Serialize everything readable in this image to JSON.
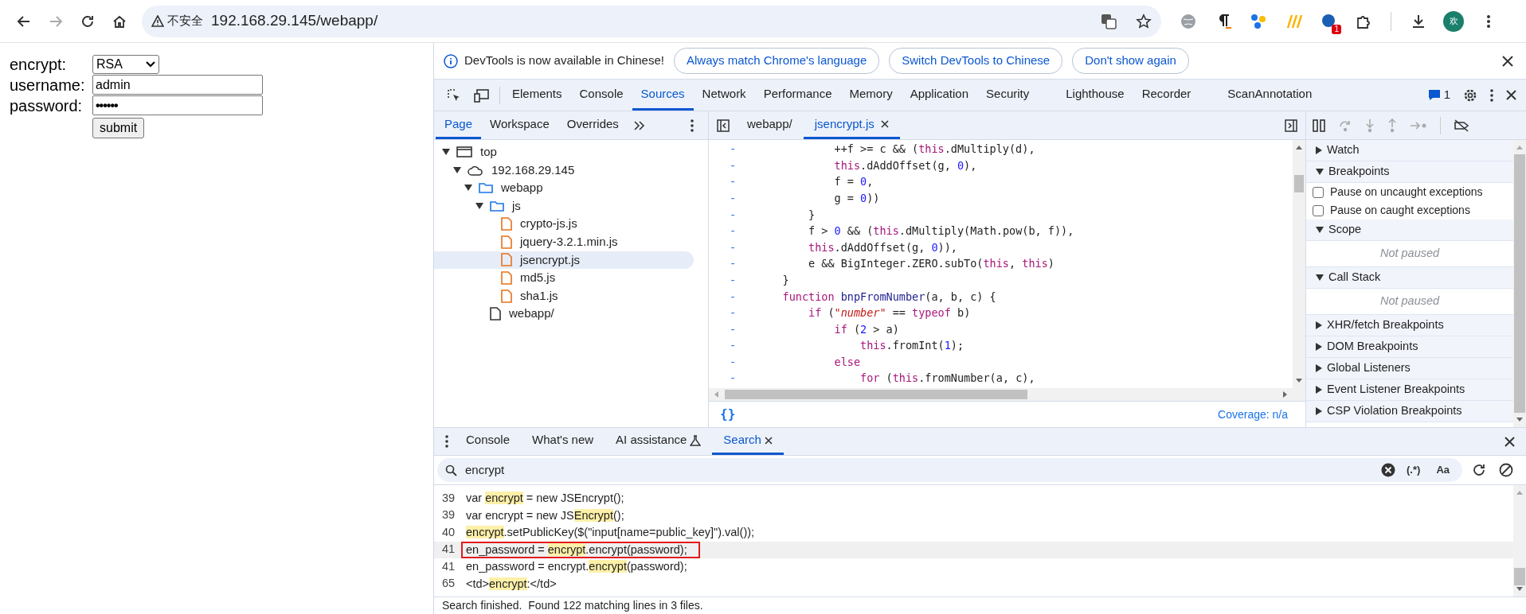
{
  "browser": {
    "security_label": "不安全",
    "url": "192.168.29.145/webapp/",
    "extension_badge": "1",
    "avatar_text": "欢"
  },
  "form": {
    "rows": [
      {
        "kind": "select",
        "label": "encrypt:",
        "value": "RSA"
      },
      {
        "kind": "text",
        "label": "username:",
        "value": "admin"
      },
      {
        "kind": "password",
        "label": "password:",
        "value": "••••••"
      }
    ],
    "submit": "submit"
  },
  "infobar": {
    "message": "DevTools is now available in Chinese!",
    "buttons": [
      "Always match Chrome's language",
      "Switch DevTools to Chinese",
      "Don't show again"
    ]
  },
  "main_tabs": [
    {
      "label": "Elements",
      "selected": false
    },
    {
      "label": "Console",
      "selected": false
    },
    {
      "label": "Sources",
      "selected": true
    },
    {
      "label": "Network",
      "selected": false
    },
    {
      "label": "Performance",
      "selected": false
    },
    {
      "label": "Memory",
      "selected": false
    },
    {
      "label": "Application",
      "selected": false
    },
    {
      "label": "Security",
      "selected": false
    },
    {
      "label": "Lighthouse",
      "selected": false
    },
    {
      "label": "Recorder",
      "selected": false
    },
    {
      "label": "ScanAnnotation",
      "selected": false
    }
  ],
  "issues_count": "1",
  "navigator_tabs": [
    {
      "label": "Page",
      "selected": true
    },
    {
      "label": "Workspace",
      "selected": false
    },
    {
      "label": "Overrides",
      "selected": false
    }
  ],
  "editor_tabs": [
    {
      "label": "webapp/",
      "selected": false,
      "closable": false
    },
    {
      "label": "jsencrypt.js",
      "selected": true,
      "closable": true
    }
  ],
  "file_tree": [
    {
      "label": "top",
      "kind": "frame",
      "expanded": true,
      "selected": false,
      "children": [
        {
          "label": "192.168.29.145",
          "kind": "domain",
          "expanded": true,
          "selected": false,
          "children": [
            {
              "label": "webapp",
              "kind": "folder",
              "expanded": true,
              "selected": false,
              "children": [
                {
                  "label": "js",
                  "kind": "folder",
                  "expanded": true,
                  "selected": false,
                  "children": [
                    {
                      "label": "crypto-js.js",
                      "kind": "file",
                      "selected": false
                    },
                    {
                      "label": "jquery-3.2.1.min.js",
                      "kind": "file",
                      "selected": false
                    },
                    {
                      "label": "jsencrypt.js",
                      "kind": "file",
                      "selected": true
                    },
                    {
                      "label": "md5.js",
                      "kind": "file",
                      "selected": false
                    },
                    {
                      "label": "sha1.js",
                      "kind": "file",
                      "selected": false
                    }
                  ]
                },
                {
                  "label": "webapp/",
                  "kind": "document",
                  "selected": false
                }
              ]
            }
          ]
        }
      ]
    }
  ],
  "code_lines": [
    {
      "gutter": "-",
      "tokens": [
        {
          "kind": "plain",
          "text": "            ++f >= c && ("
        },
        {
          "kind": "kw",
          "text": "this"
        },
        {
          "kind": "plain",
          "text": ".dMultiply(d),"
        }
      ]
    },
    {
      "gutter": "-",
      "tokens": [
        {
          "kind": "kw",
          "text": "            this"
        },
        {
          "kind": "plain",
          "text": ".dAddOffset(g, "
        },
        {
          "kind": "num",
          "text": "0"
        },
        {
          "kind": "plain",
          "text": "),"
        }
      ]
    },
    {
      "gutter": "-",
      "tokens": [
        {
          "kind": "plain",
          "text": "            f = "
        },
        {
          "kind": "num",
          "text": "0"
        },
        {
          "kind": "plain",
          "text": ","
        }
      ]
    },
    {
      "gutter": "-",
      "tokens": [
        {
          "kind": "plain",
          "text": "            g = "
        },
        {
          "kind": "num",
          "text": "0"
        },
        {
          "kind": "plain",
          "text": "))"
        }
      ]
    },
    {
      "gutter": "-",
      "tokens": [
        {
          "kind": "plain",
          "text": "        }"
        }
      ]
    },
    {
      "gutter": "-",
      "tokens": [
        {
          "kind": "plain",
          "text": "        f > "
        },
        {
          "kind": "num",
          "text": "0"
        },
        {
          "kind": "plain",
          "text": " && ("
        },
        {
          "kind": "kw",
          "text": "this"
        },
        {
          "kind": "plain",
          "text": ".dMultiply(Math.pow(b, f)),"
        }
      ]
    },
    {
      "gutter": "-",
      "tokens": [
        {
          "kind": "kw",
          "text": "        this"
        },
        {
          "kind": "plain",
          "text": ".dAddOffset(g, "
        },
        {
          "kind": "num",
          "text": "0"
        },
        {
          "kind": "plain",
          "text": ")),"
        }
      ]
    },
    {
      "gutter": "-",
      "tokens": [
        {
          "kind": "plain",
          "text": "        e && BigInteger.ZERO.subTo("
        },
        {
          "kind": "kw",
          "text": "this"
        },
        {
          "kind": "plain",
          "text": ", "
        },
        {
          "kind": "kw",
          "text": "this"
        },
        {
          "kind": "plain",
          "text": ")"
        }
      ]
    },
    {
      "gutter": "-",
      "tokens": [
        {
          "kind": "plain",
          "text": "    }"
        }
      ]
    },
    {
      "gutter": "-",
      "tokens": [
        {
          "kind": "kw",
          "text": "    function"
        },
        {
          "kind": "fn",
          "text": " bnpFromNumber"
        },
        {
          "kind": "plain",
          "text": "(a, b, c) {"
        }
      ]
    },
    {
      "gutter": "-",
      "tokens": [
        {
          "kind": "kw",
          "text": "        if"
        },
        {
          "kind": "plain",
          "text": " ("
        },
        {
          "kind": "str",
          "text": "\"number\""
        },
        {
          "kind": "plain",
          "text": " == "
        },
        {
          "kind": "kw",
          "text": "typeof"
        },
        {
          "kind": "plain",
          "text": " b)"
        }
      ]
    },
    {
      "gutter": "-",
      "tokens": [
        {
          "kind": "kw",
          "text": "            if"
        },
        {
          "kind": "plain",
          "text": " ("
        },
        {
          "kind": "num",
          "text": "2"
        },
        {
          "kind": "plain",
          "text": " > a)"
        }
      ]
    },
    {
      "gutter": "-",
      "tokens": [
        {
          "kind": "kw",
          "text": "                this"
        },
        {
          "kind": "plain",
          "text": ".fromInt("
        },
        {
          "kind": "num",
          "text": "1"
        },
        {
          "kind": "plain",
          "text": ");"
        }
      ]
    },
    {
      "gutter": "-",
      "tokens": [
        {
          "kind": "kw",
          "text": "            else"
        }
      ]
    },
    {
      "gutter": "-",
      "tokens": [
        {
          "kind": "kw",
          "text": "                for"
        },
        {
          "kind": "plain",
          "text": " ("
        },
        {
          "kind": "kw",
          "text": "this"
        },
        {
          "kind": "plain",
          "text": ".fromNumber(a, c),"
        }
      ]
    }
  ],
  "format_button": "{}",
  "coverage": "Coverage: n/a",
  "debug_sections": [
    {
      "title": "Watch",
      "expanded": false
    },
    {
      "title": "Breakpoints",
      "expanded": true,
      "checkboxes": [
        {
          "label": "Pause on uncaught exceptions",
          "checked": false
        },
        {
          "label": "Pause on caught exceptions",
          "checked": false
        }
      ]
    },
    {
      "title": "Scope",
      "expanded": true,
      "note": "Not paused"
    },
    {
      "title": "Call Stack",
      "expanded": true,
      "note": "Not paused"
    },
    {
      "title": "XHR/fetch Breakpoints",
      "expanded": false
    },
    {
      "title": "DOM Breakpoints",
      "expanded": false
    },
    {
      "title": "Global Listeners",
      "expanded": false
    },
    {
      "title": "Event Listener Breakpoints",
      "expanded": false
    },
    {
      "title": "CSP Violation Breakpoints",
      "expanded": false
    }
  ],
  "drawer_tabs": [
    {
      "label": "Console",
      "kind": "plain",
      "selected": false
    },
    {
      "label": "What's new",
      "kind": "plain",
      "selected": false
    },
    {
      "label": "AI assistance",
      "kind": "lab",
      "selected": false
    },
    {
      "label": "Search",
      "kind": "closable",
      "selected": true
    }
  ],
  "search": {
    "query": "encrypt",
    "regex_button": "(.*)",
    "case_button": "Aa"
  },
  "results": [
    {
      "line": "39",
      "selected": false,
      "boxed": false,
      "segments": [
        {
          "text": "var ",
          "match": false
        },
        {
          "text": "encrypt",
          "match": true
        },
        {
          "text": " = new JSEncrypt();",
          "match": false
        }
      ]
    },
    {
      "line": "39",
      "selected": false,
      "boxed": false,
      "segments": [
        {
          "text": "var encrypt = new JS",
          "match": false
        },
        {
          "text": "Encrypt",
          "match": true
        },
        {
          "text": "();",
          "match": false
        }
      ]
    },
    {
      "line": "40",
      "selected": false,
      "boxed": false,
      "segments": [
        {
          "text": "encrypt",
          "match": true
        },
        {
          "text": ".setPublicKey($(\"input[name=public_key]\").val());",
          "match": false
        }
      ]
    },
    {
      "line": "41",
      "selected": true,
      "boxed": true,
      "segments": [
        {
          "text": "en_password = ",
          "match": false
        },
        {
          "text": "encrypt",
          "match": true
        },
        {
          "text": ".encrypt(password);",
          "match": false
        }
      ]
    },
    {
      "line": "41",
      "selected": false,
      "boxed": false,
      "segments": [
        {
          "text": "en_password = encrypt.",
          "match": false
        },
        {
          "text": "encrypt",
          "match": true
        },
        {
          "text": "(password);",
          "match": false
        }
      ]
    },
    {
      "line": "65",
      "selected": false,
      "boxed": false,
      "segments": [
        {
          "text": "<td>",
          "match": false
        },
        {
          "text": "encrypt",
          "match": true
        },
        {
          "text": ":</td>",
          "match": false
        }
      ]
    }
  ],
  "status": "Search finished.  Found 122 matching lines in 3 files."
}
